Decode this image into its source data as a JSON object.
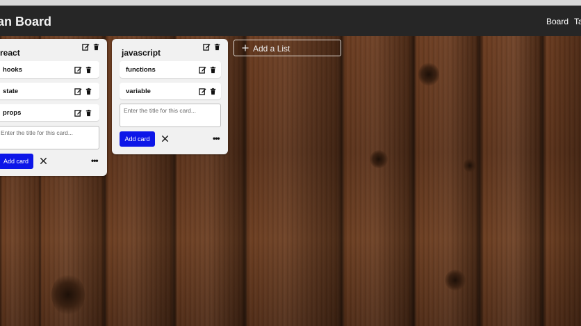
{
  "header": {
    "title": "nban Board",
    "nav": [
      "Board",
      "Ta"
    ]
  },
  "lists": [
    {
      "title": "react",
      "cards": [
        "hooks",
        "state",
        "props"
      ],
      "input_placeholder": "Enter the title for this card...",
      "add_card_label": "Add card",
      "more_label": "•••"
    },
    {
      "title": "javascript",
      "cards": [
        "functions",
        "variable"
      ],
      "input_placeholder": "Enter the title for this card...",
      "add_card_label": "Add card",
      "more_label": "•••"
    }
  ],
  "add_list_label": "Add a List",
  "icons": {
    "edit": "edit-icon",
    "delete": "trash-icon",
    "close": "close-icon",
    "add": "plus-icon"
  },
  "colors": {
    "topbar": "#262626",
    "list_bg": "#f1f1f1",
    "primary_button": "#0d16e8"
  }
}
